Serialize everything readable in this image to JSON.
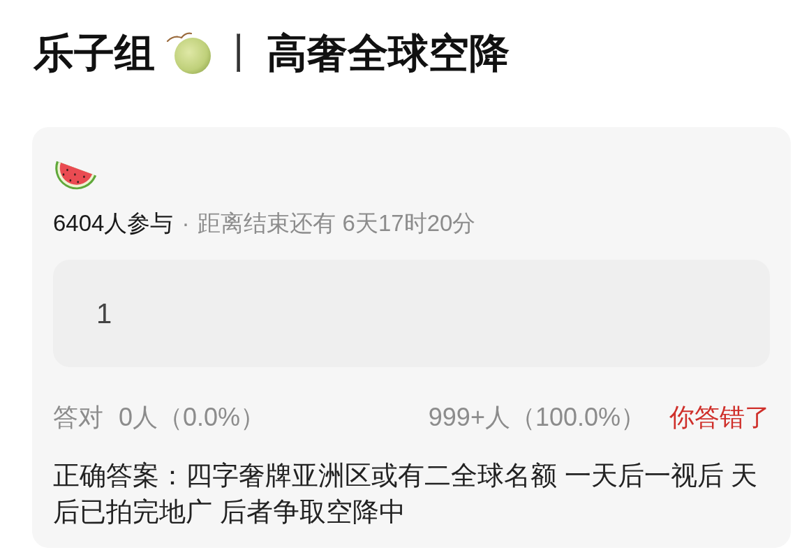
{
  "header": {
    "group": "乐子组",
    "separator": "丨",
    "title": "高奢全球空降"
  },
  "poll": {
    "participants": "6404人参与",
    "dot": "·",
    "countdown": "距离结束还有 6天17时20分",
    "answer": {
      "value": "1"
    },
    "results": {
      "correct_label": "答对",
      "correct_count": "0人（0.0%）",
      "wrong_count": "999+人（100.0%）",
      "verdict": "你答错了",
      "user_correct": false
    },
    "correct_answer": "正确答案：四字奢牌亚洲区或有二全球名额 一天后一视后 天后已拍完地广 后者争取空降中"
  }
}
